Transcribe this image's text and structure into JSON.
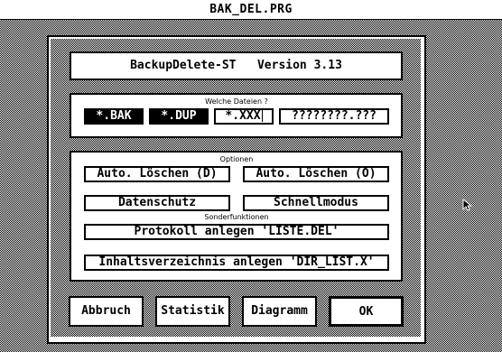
{
  "window": {
    "title": "BAK_DEL.PRG"
  },
  "header": {
    "text": "BackupDelete-ST   Version 3.13"
  },
  "files": {
    "label": "Welche Dateien ?",
    "items": [
      "*.BAK",
      "*.DUP",
      "*.XXX",
      "????????.???"
    ]
  },
  "options": {
    "label": "Optionen",
    "auto_delete_d": "Auto. Löschen (D)",
    "auto_delete_o": "Auto. Löschen (O)",
    "datenschutz": "Datenschutz",
    "schnellmodus": "Schnellmodus"
  },
  "special": {
    "label": "Sonderfunktionen",
    "protokoll": "Protokoll anlegen 'LISTE.DEL'",
    "inhalt": "Inhaltsverzeichnis anlegen 'DIR_LIST.X'"
  },
  "buttons": {
    "abbruch": "Abbruch",
    "statistik": "Statistik",
    "diagramm": "Diagramm",
    "ok": "OK"
  }
}
